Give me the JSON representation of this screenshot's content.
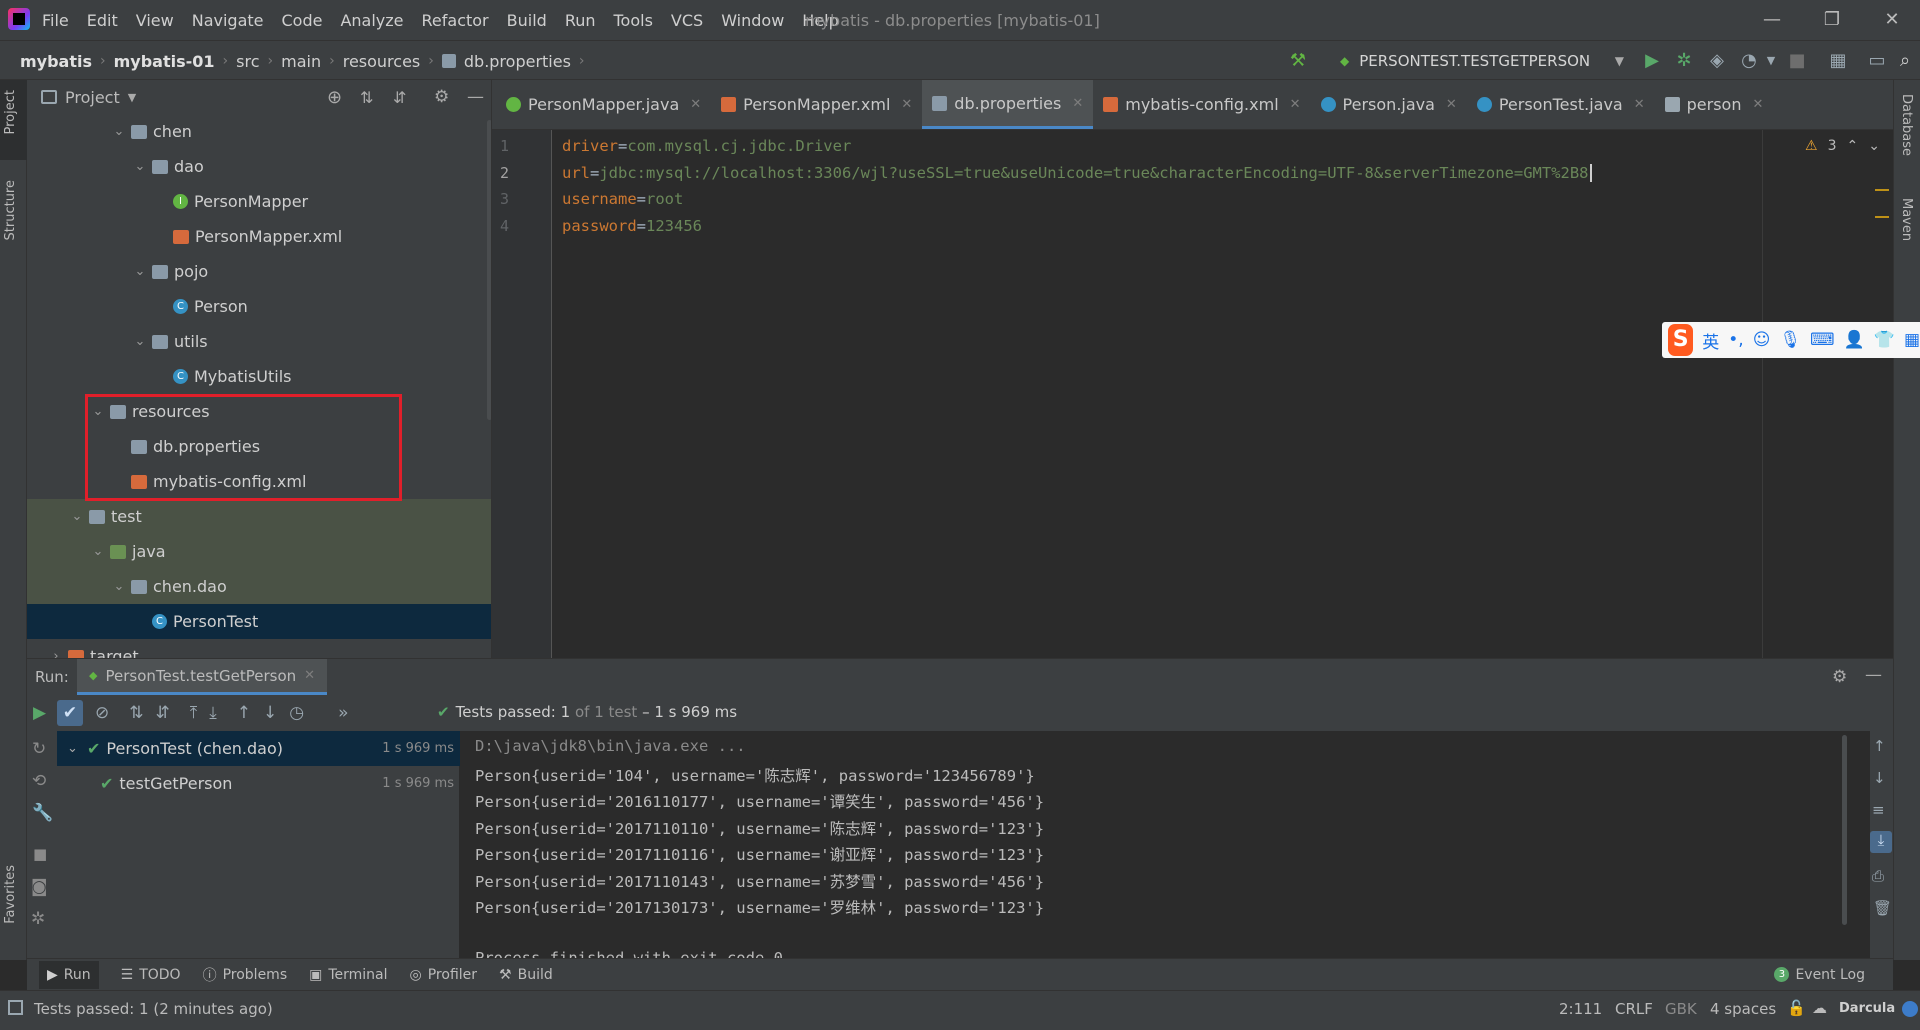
{
  "window": {
    "title": "mybatis - db.properties [mybatis-01]",
    "menu": [
      "File",
      "Edit",
      "View",
      "Navigate",
      "Code",
      "Analyze",
      "Refactor",
      "Build",
      "Run",
      "Tools",
      "VCS",
      "Window",
      "Help"
    ],
    "minimize": "—",
    "restore": "❐",
    "close": "✕"
  },
  "breadcrumb": [
    "mybatis",
    "mybatis-01",
    "src",
    "main",
    "resources",
    "db.properties"
  ],
  "run_config": "PERSONTEST.TESTGETPERSON",
  "side_tabs": {
    "left": [
      "Project",
      "Structure",
      "Favorites"
    ],
    "right": [
      "Database",
      "Maven"
    ]
  },
  "project": {
    "title": "Project",
    "tree": [
      {
        "label": "chen",
        "icon": "folder",
        "depth": 4,
        "expanded": true
      },
      {
        "label": "dao",
        "icon": "folder",
        "depth": 5,
        "expanded": true
      },
      {
        "label": "PersonMapper",
        "icon": "interface",
        "depth": 6
      },
      {
        "label": "PersonMapper.xml",
        "icon": "xml",
        "depth": 6
      },
      {
        "label": "pojo",
        "icon": "folder",
        "depth": 5,
        "expanded": true
      },
      {
        "label": "Person",
        "icon": "class",
        "depth": 6
      },
      {
        "label": "utils",
        "icon": "folder",
        "depth": 5,
        "expanded": true
      },
      {
        "label": "MybatisUtils",
        "icon": "class",
        "depth": 6
      },
      {
        "label": "resources",
        "icon": "resources-folder",
        "depth": 3,
        "expanded": true
      },
      {
        "label": "db.properties",
        "icon": "properties",
        "depth": 4
      },
      {
        "label": "mybatis-config.xml",
        "icon": "xml",
        "depth": 4
      },
      {
        "label": "test",
        "icon": "folder",
        "depth": 2,
        "expanded": true
      },
      {
        "label": "java",
        "icon": "test-folder",
        "depth": 3,
        "expanded": true
      },
      {
        "label": "chen.dao",
        "icon": "folder",
        "depth": 4,
        "expanded": true
      },
      {
        "label": "PersonTest",
        "icon": "test-class",
        "depth": 5,
        "selected": true
      },
      {
        "label": "target",
        "icon": "target-folder",
        "depth": 1,
        "expanded": false
      }
    ]
  },
  "editor_tabs": [
    {
      "label": "PersonMapper.java",
      "icon": "interface",
      "color": "#62b543"
    },
    {
      "label": "PersonMapper.xml",
      "icon": "xml",
      "color": "#d66a3c"
    },
    {
      "label": "db.properties",
      "icon": "properties",
      "color": "#8a9aa8",
      "active": true
    },
    {
      "label": "mybatis-config.xml",
      "icon": "xml",
      "color": "#d66a3c"
    },
    {
      "label": "Person.java",
      "icon": "class",
      "color": "#3592c4"
    },
    {
      "label": "PersonTest.java",
      "icon": "test-class",
      "color": "#3592c4"
    },
    {
      "label": "person",
      "icon": "table",
      "color": "#9aa7b0"
    }
  ],
  "editor": {
    "warnings": "3",
    "lines": [
      {
        "n": "1",
        "key": "driver",
        "value": "com.mysql.cj.jdbc.Driver"
      },
      {
        "n": "2",
        "key": "url",
        "value": "jdbc:mysql://localhost:3306/wjl?useSSL=true&useUnicode=true&characterEncoding=UTF-8&serverTimezone=GMT%2B8"
      },
      {
        "n": "3",
        "key": "username",
        "value": "root"
      },
      {
        "n": "4",
        "key": "password",
        "value": "123456"
      }
    ]
  },
  "ime": {
    "lang": "英",
    "punct": "•,"
  },
  "run": {
    "label": "Run:",
    "tab": "PersonTest.testGetPerson",
    "status": {
      "prefix": "Tests passed:",
      "count": "1",
      "of": "of 1 test",
      "time": "– 1 s 969 ms"
    },
    "tests": [
      {
        "label": "PersonTest (chen.dao)",
        "time": "1 s 969 ms"
      },
      {
        "label": "testGetPerson",
        "time": "1 s 969 ms"
      }
    ],
    "console": [
      "D:\\java\\jdk8\\bin\\java.exe ...",
      "Person{userid='104', username='陈志辉', password='123456789'}",
      "Person{userid='2016110177', username='谭笑生', password='456'}",
      "Person{userid='2017110110', username='陈志辉', password='123'}",
      "Person{userid='2017110116', username='谢亚辉', password='123'}",
      "Person{userid='2017110143', username='苏梦雪', password='456'}",
      "Person{userid='2017130173', username='罗维林', password='123'}",
      "",
      "Process finished with exit code 0"
    ]
  },
  "tool_windows": [
    "Run",
    "TODO",
    "Problems",
    "Terminal",
    "Profiler",
    "Build"
  ],
  "event_log": {
    "count": "3",
    "label": "Event Log"
  },
  "statusbar": {
    "message": "Tests passed: 1 (2 minutes ago)",
    "position": "2:111",
    "line_sep": "CRLF",
    "encoding": "GBK",
    "indent": "4 spaces",
    "theme": "Darcula"
  }
}
